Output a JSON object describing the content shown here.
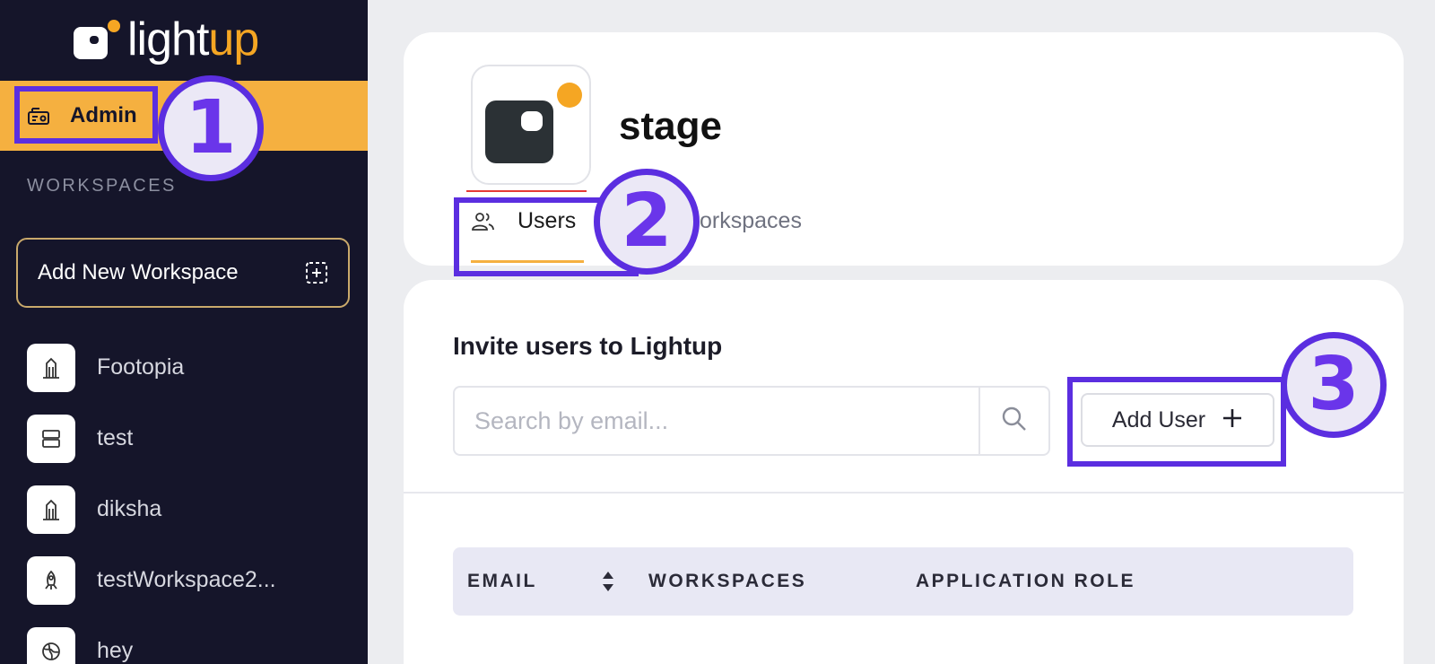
{
  "brand": {
    "name_main": "light",
    "name_accent": "up",
    "logo_icon": "lightup-logo",
    "accent_color": "#f5a623"
  },
  "sidebar": {
    "admin_label": "Admin",
    "workspaces_heading": "WORKSPACES",
    "add_workspace_label": "Add New Workspace",
    "workspaces": [
      {
        "name": "Footopia",
        "icon": "building-icon"
      },
      {
        "name": "test",
        "icon": "server-icon"
      },
      {
        "name": "diksha",
        "icon": "building-icon"
      },
      {
        "name": "testWorkspace2...",
        "icon": "rocket-icon"
      },
      {
        "name": "hey",
        "icon": "globe-icon"
      }
    ]
  },
  "workspace": {
    "title": "stage",
    "tabs": [
      {
        "label": "Users",
        "icon": "users-icon",
        "active": true
      },
      {
        "label": "orkspaces",
        "active": false
      }
    ]
  },
  "invite": {
    "title": "Invite users to Lightup",
    "search_placeholder": "Search by email...",
    "add_user_label": "Add User"
  },
  "table": {
    "columns": [
      "EMAIL",
      "WORKSPACES",
      "APPLICATION ROLE"
    ]
  },
  "annotations": [
    "1",
    "2",
    "3"
  ],
  "colors": {
    "sidebar_bg": "#15152a",
    "highlight": "#f5b040",
    "annotation": "#5b2ee0"
  }
}
